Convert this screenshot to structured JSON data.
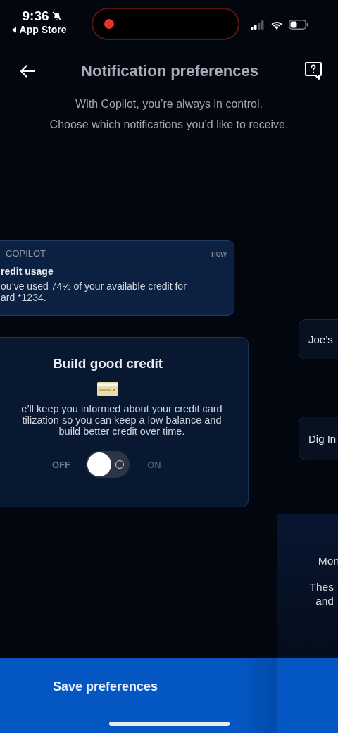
{
  "status_bar": {
    "time": "9:36",
    "back_label": "App Store"
  },
  "header": {
    "title": "Notification preferences"
  },
  "intro": "With Copilot, you’re always in control.\nChoose which notifications you’d like to receive.",
  "notification_preview": {
    "app": "COPILOT",
    "time": "now",
    "title": "redit usage",
    "body": "ou’ve used 74% of your available credit for\nard *1234."
  },
  "feature_card": {
    "title": "Build good credit",
    "description": "e’ll keep you informed about your credit card\ntilization so you can keep a low balance and\nbuild better credit over time.",
    "toggle": {
      "off_label": "OFF",
      "on_label": "ON",
      "on": false
    }
  },
  "side_cards": [
    {
      "label": "Joe’s"
    },
    {
      "label": "Dig In"
    }
  ],
  "side_panel": {
    "heading": "Mon",
    "text": "Thes\nand"
  },
  "save_button": "Save preferences"
}
